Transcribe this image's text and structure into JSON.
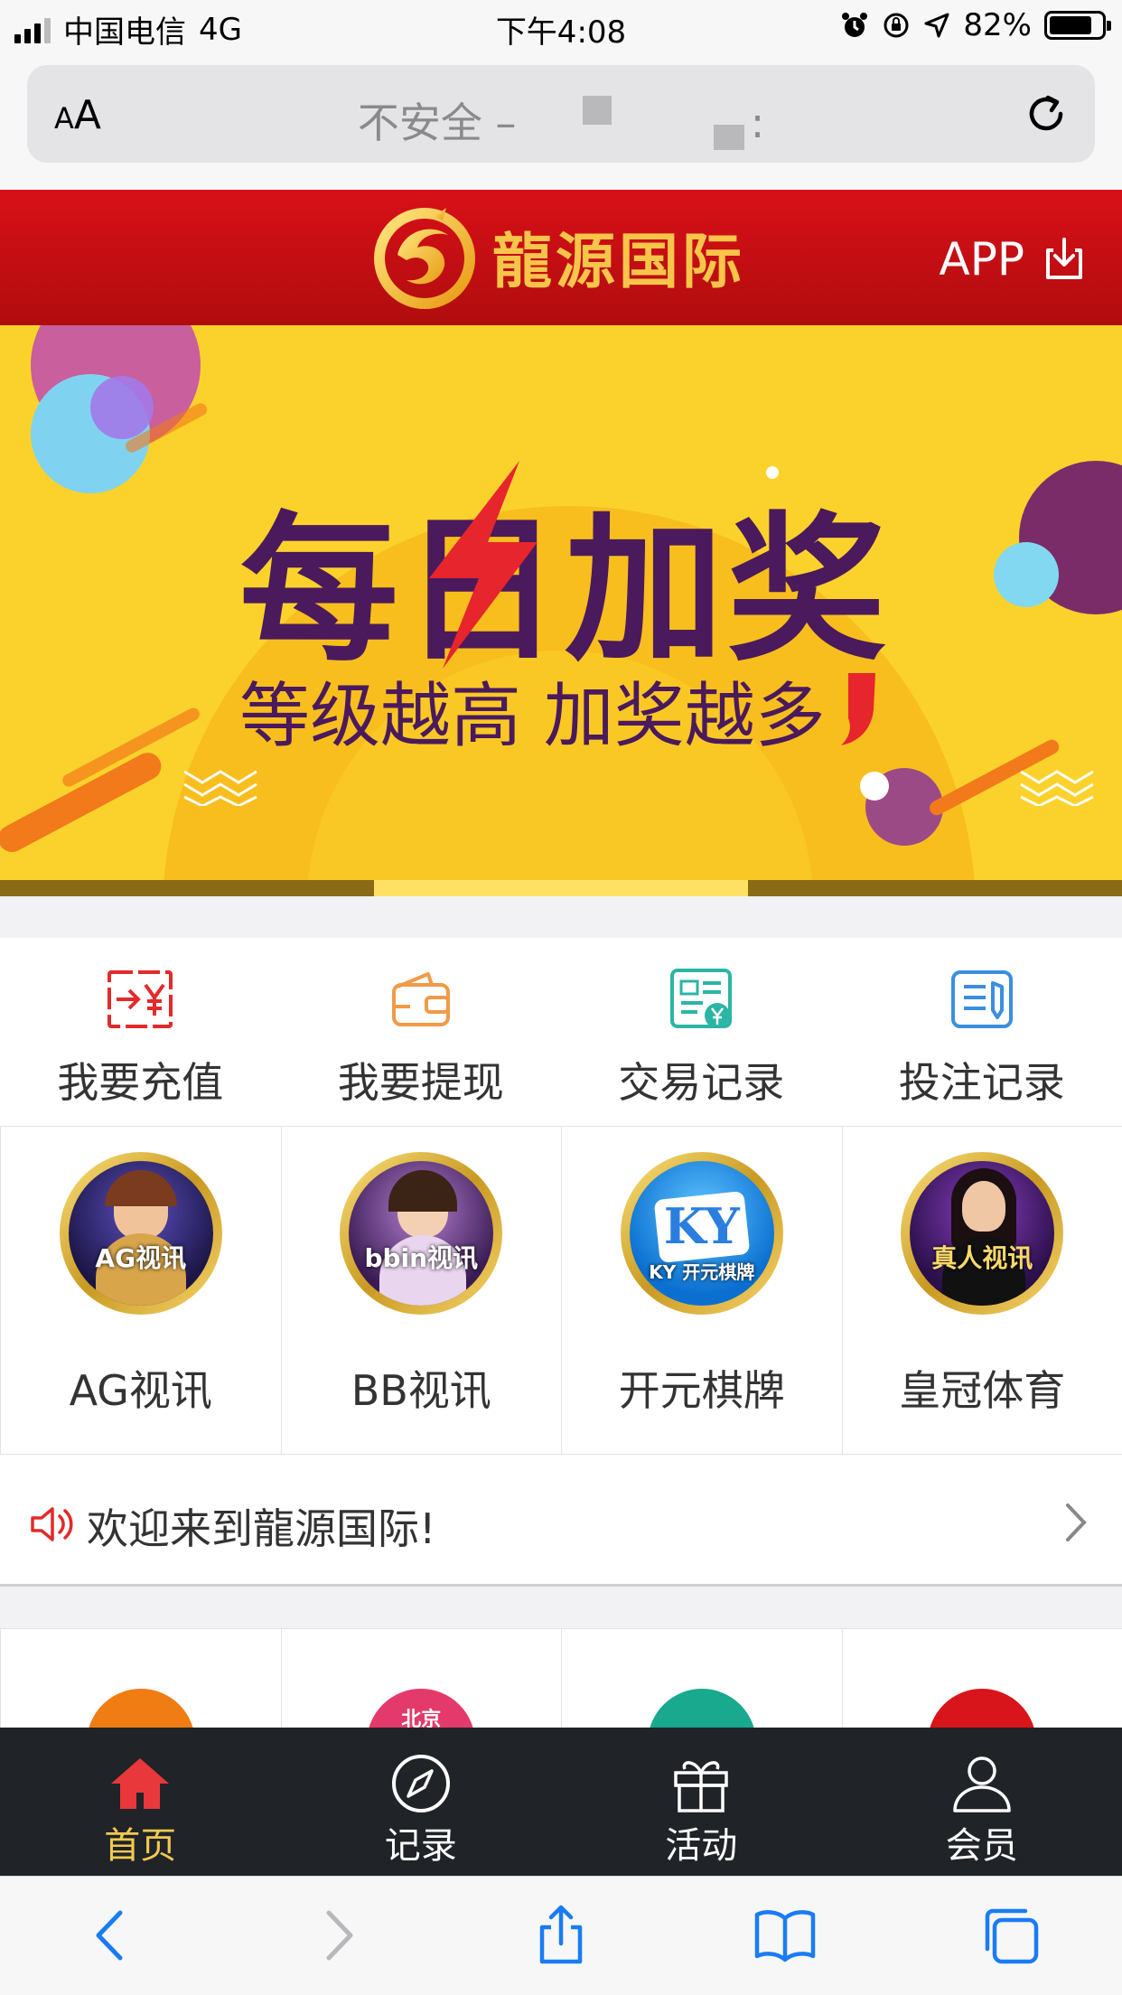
{
  "status_bar": {
    "carrier": "中国电信",
    "network": "4G",
    "time": "下午4:08",
    "battery": "82%",
    "battery_level": 0.82
  },
  "browser": {
    "aa_small": "A",
    "aa_large": "A",
    "url_prefix": "不安全 –",
    "url_suffix": ":"
  },
  "header": {
    "brand": "龍源国际",
    "app_label": "APP"
  },
  "banner": {
    "title": "每日加奖",
    "subtitle": "等级越高 加奖越多",
    "slide_index": 2,
    "slide_count": 3
  },
  "quick_actions": [
    {
      "label": "我要充值",
      "icon": "recharge-icon"
    },
    {
      "label": "我要提现",
      "icon": "wallet-icon"
    },
    {
      "label": "交易记录",
      "icon": "transaction-record-icon"
    },
    {
      "label": "投注记录",
      "icon": "bet-record-icon"
    }
  ],
  "games": [
    {
      "label": "AG视讯",
      "badge": "AG视讯"
    },
    {
      "label": "BB视讯",
      "badge": "bbin视讯"
    },
    {
      "label": "开元棋牌",
      "badge": "KY 开元棋牌"
    },
    {
      "label": "皇冠体育",
      "badge": "真人视讯"
    }
  ],
  "notice": {
    "text": "欢迎来到龍源国际!"
  },
  "lottery": [
    {
      "badge": "",
      "color": "#f07c14"
    },
    {
      "badge": "北京",
      "color": "#e43a6b"
    },
    {
      "badge": "",
      "color": "#18a98e"
    },
    {
      "badge": "",
      "color": "#d8151a"
    }
  ],
  "tab_bar": [
    {
      "label": "首页",
      "icon": "home-icon",
      "active": true
    },
    {
      "label": "记录",
      "icon": "compass-icon",
      "active": false
    },
    {
      "label": "活动",
      "icon": "gift-icon",
      "active": false
    },
    {
      "label": "会员",
      "icon": "user-icon",
      "active": false
    }
  ],
  "colors": {
    "header_red": "#c40f12",
    "gold": "#f7c54a",
    "banner_yellow": "#fbd22c",
    "banner_purple": "#4a1a5c",
    "tabbar_bg": "#202428",
    "active_tab": "#f3c94f",
    "safari_blue": "#1a7cf5"
  }
}
